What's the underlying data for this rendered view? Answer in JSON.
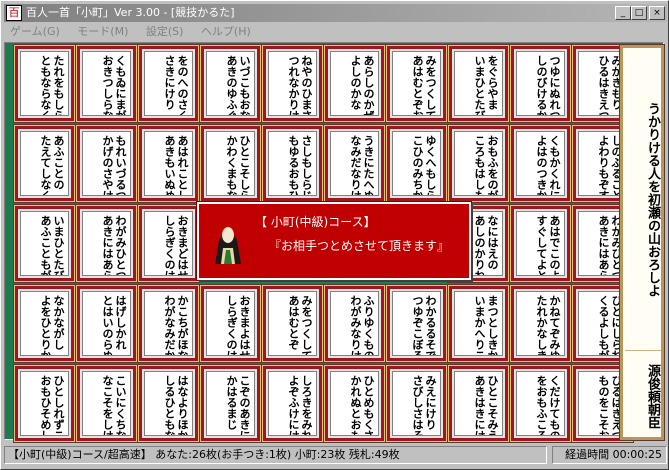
{
  "window": {
    "title": "百人一首「小町」Ver 3.00 - [競技かるた]",
    "app_icon": "百",
    "minimize": "_",
    "maximize": "□",
    "close": "×"
  },
  "menu": [
    "ゲーム(G)",
    "モード(M)",
    "設定(S)",
    "ヘルプ(H)"
  ],
  "cards": [
    "たれをもしらむ\nともならなくに",
    "くもゐにまがふ\nおきつしらなみ",
    "をのへのさくら\nさきにけり",
    "いづこもおなじ\nあきのゆふぐれ",
    "ねやのひまさへ\nつれなかりけり",
    "あらしのかぜに\nよしのかな",
    "みをつくしても\nあはむとぞおもふ",
    "をぐらやま\nいまひとたびの",
    "つゆにぬれつつ\nしのびけるかな",
    "みかきもり\nひるはきえつつ",
    "あふことの\nたえてしなくは",
    "もれいづるつきの\nかげのさやけさ",
    "あはれことしの\nあきもいぬめり",
    "ひとこそしらね\nかわくまもなし",
    "さしもしらじな\nもゆるおもひを",
    "うきにたへぬは\nなみだなりけり",
    "ゆくへもしらぬ\nこひのみちかな",
    "おもふをのが\nころもはしもに",
    "くもかくれにし\nよはのつきかな",
    "しのぶることの\nよわりもぞする",
    "いまひとたびの\nあふこともがな",
    "わがみひとつの\nあきにはあらねど",
    "おきまどはせる\nしらぎくのはな",
    "なにはえの\nあしのかりね",
    "あはでこのよを\nすぐしてよとや",
    "わかみひとつの\nあきにはあらね",
    "なかながし\nよをひとりかも",
    "はげしかれ\nとはいのらぬを",
    "かこちがほなる\nわがなみだかな",
    "おきまよはせる\nしらぎくのはな",
    "みをつくしても\nあはむとぞ",
    "ふりゆくものは\nわがみなりけり",
    "わかるるそでに\nつゆぞこぼるる",
    "まつとしきかば\nいまかへりこむ",
    "かねてぞみゆる\nたれかなしき",
    "ひとにしられで\nくるよしもがな",
    "ひとしれずこそ\nおもひそめしか",
    "こいにくちなむ\nなこそをしけれ",
    "はなよりほかに\nしるひともなし",
    "こぞのあきには\nかはるまじ",
    "しろきをみれば\nよぞふけにける",
    "ひとめもくさも\nかれぬとおもへば",
    "みえにけり\nさびしさはそこ",
    "ひとこそみえね\nあきはきにけり",
    "くだけてもの\nをおもふころかな",
    "ひるはきえつつ\nものをこそおもへ",
    "くもがくれにし\nよはのつきかげ"
  ],
  "reading_card": {
    "text": "うかりける人を初瀬の山おろしよ",
    "author": "源俊頼朝臣"
  },
  "dialog": {
    "line1": "【 小町(中級)コース】",
    "line2": "『お相手つとめさせて頂きます』"
  },
  "status": {
    "text": "【小町(中級)コース/超高速】 あなた:26枚(お手つき:1枚)  小町:23枚  残札:49枚",
    "timer": "経過時間 00:00:25"
  }
}
